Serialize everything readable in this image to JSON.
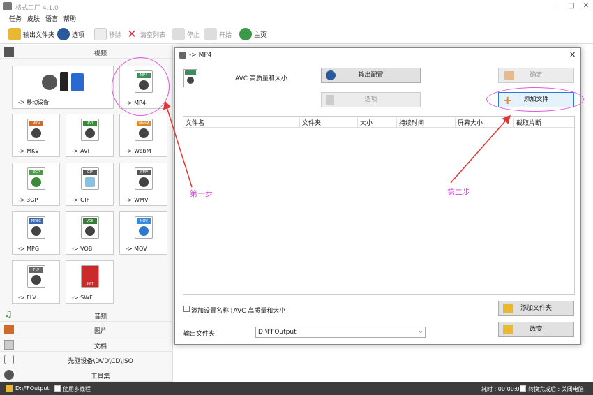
{
  "app": {
    "title": "格式工厂 4.1.0"
  },
  "menu": [
    "任务",
    "皮肤",
    "语言",
    "帮助"
  ],
  "toolbar": {
    "output_folder": "输出文件夹",
    "options": "选项",
    "remove": "移除",
    "clear_list": "清空列表",
    "stop": "停止",
    "start": "开始",
    "home": "主页"
  },
  "left": {
    "video_header": "视频",
    "tiles": [
      {
        "label": "-> 移动设备"
      },
      {
        "label": "-> MP4",
        "badge": "MP4",
        "color": "#3c8f5a"
      },
      {
        "label": "-> MKV",
        "badge": "MKV",
        "color": "#d06a2a"
      },
      {
        "label": "-> AVI",
        "badge": "AVI",
        "color": "#3a8a3a"
      },
      {
        "label": "-> WebM",
        "badge": "WebM",
        "color": "#d68a2a"
      },
      {
        "label": "-> 3GP",
        "badge": "3GP",
        "color": "#4c9a4c"
      },
      {
        "label": "-> GIF",
        "badge": "GIF",
        "color": "#555555"
      },
      {
        "label": "-> WMV",
        "badge": "WMV",
        "color": "#555555"
      },
      {
        "label": "-> MPG",
        "badge": "MPEG",
        "color": "#3a6ab0"
      },
      {
        "label": "-> VOB",
        "badge": "VOB",
        "color": "#3a7a3a"
      },
      {
        "label": "-> MOV",
        "badge": "MOV",
        "color": "#3a8ad6"
      },
      {
        "label": "-> FLV",
        "badge": "FLV",
        "color": "#666666"
      },
      {
        "label": "-> SWF",
        "badge": "SWF",
        "color": "#cc2a2a"
      }
    ],
    "categories": [
      "音频",
      "图片",
      "文档",
      "光驱设备\\DVD\\CD\\ISO",
      "工具集"
    ]
  },
  "dialog": {
    "title": "-> MP4",
    "profile": "AVC 高质量和大小",
    "output_config": "输出配置",
    "options": "选项",
    "ok": "确定",
    "add_file": "添加文件",
    "columns": [
      "文件名",
      "文件夹",
      "大小",
      "持续时间",
      "屏幕大小",
      "截取片断"
    ],
    "add_setting_name": "添加设置名称 [AVC 高质量和大小]",
    "add_folder": "添加文件夹",
    "output_folder_label": "输出文件夹",
    "output_folder_value": "D:\\FFOutput",
    "change": "改变"
  },
  "annotations": {
    "step1": "第一步",
    "step2": "第二步",
    "color": "#e05ce0"
  },
  "status": {
    "folder": "D:\\FFOutput",
    "multithread": "使用多线程",
    "elapsed": "耗时 : 00:00:00",
    "after_done": "转换完成后 : 关闭电脑"
  }
}
